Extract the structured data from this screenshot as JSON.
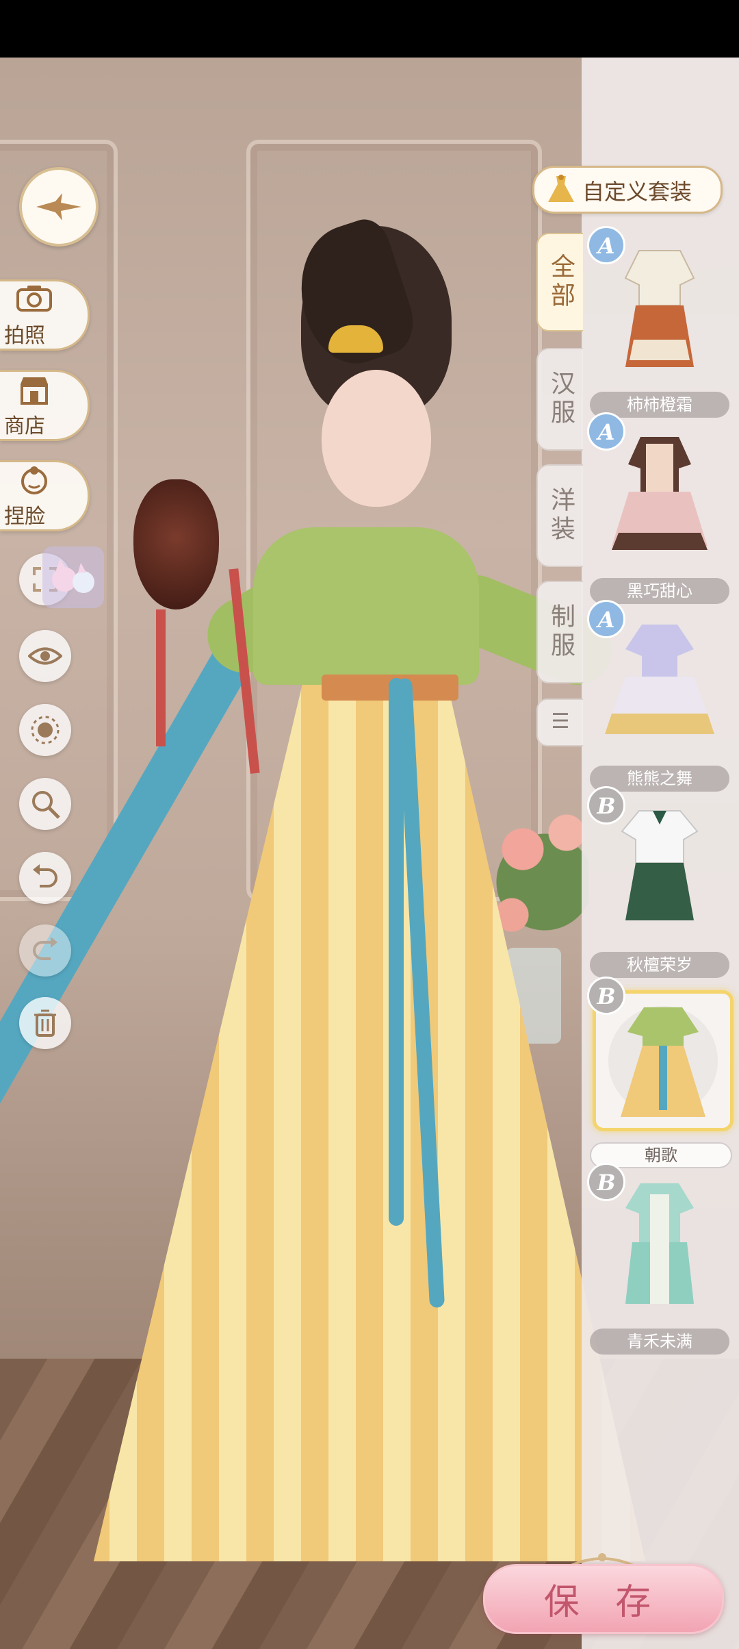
{
  "left_toolbar": {
    "photo_label": "拍照",
    "shop_label": "商店",
    "face_label": "捏脸"
  },
  "right_panel": {
    "custom_outfit_label": "自定义套装",
    "tabs": [
      {
        "label": "全部",
        "active": true
      },
      {
        "label": "汉服",
        "active": false
      },
      {
        "label": "洋装",
        "active": false
      },
      {
        "label": "制服",
        "active": false
      }
    ],
    "outfits": [
      {
        "grade": "A",
        "name": "柿柿橙霜",
        "selected": false
      },
      {
        "grade": "A",
        "name": "黑巧甜心",
        "selected": false
      },
      {
        "grade": "A",
        "name": "熊熊之舞",
        "selected": false
      },
      {
        "grade": "B",
        "name": "秋檀荣岁",
        "selected": false
      },
      {
        "grade": "B",
        "name": "朝歌",
        "selected": true
      },
      {
        "grade": "B",
        "name": "青禾未满",
        "selected": false
      }
    ]
  },
  "save_label": "保 存",
  "colors": {
    "accent_gold": "#d6b888",
    "grade_a": "#8fb9e3",
    "grade_b": "#b6b1b1",
    "save_pink": "#f2a4b3",
    "selected_border": "#f4d46c"
  }
}
